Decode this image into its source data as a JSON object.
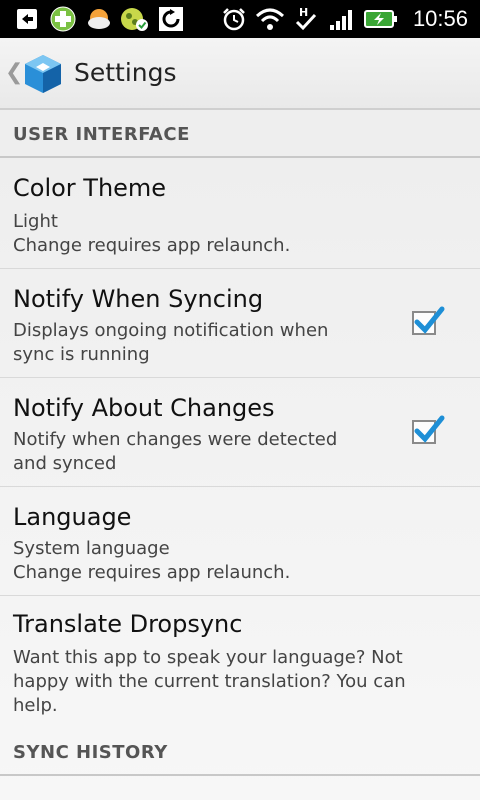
{
  "status_bar": {
    "time": "10:56",
    "icons": [
      "back-notification-icon",
      "plus-app-icon",
      "weather-icon",
      "sync-status-icon",
      "sync-icon",
      "alarm-icon",
      "wifi-icon",
      "h-data-icon",
      "signal-icon",
      "battery-charging-icon"
    ]
  },
  "action_bar": {
    "title": "Settings",
    "back_glyph": "❮"
  },
  "sections": [
    {
      "header": "USER INTERFACE"
    },
    {
      "header": "SYNC HISTORY"
    }
  ],
  "preferences": [
    {
      "title": "Color Theme",
      "summary_lines": [
        "Light",
        "Change requires app relaunch."
      ],
      "checked": null
    },
    {
      "title": "Notify When Syncing",
      "summary_lines": [
        "Displays ongoing notification when",
        "sync is running"
      ],
      "checked": true
    },
    {
      "title": "Notify About Changes",
      "summary_lines": [
        "Notify when changes were detected",
        "and synced"
      ],
      "checked": true
    },
    {
      "title": "Language",
      "summary_lines": [
        "System language",
        "Change requires app relaunch."
      ],
      "checked": null
    },
    {
      "title": "Translate Dropsync",
      "summary_lines": [
        "Want this app to speak your language? Not",
        "happy with the current translation? You can",
        "help."
      ],
      "checked": null
    }
  ],
  "colors": {
    "accent_check": "#1e8fd6",
    "header_text": "#555555"
  }
}
